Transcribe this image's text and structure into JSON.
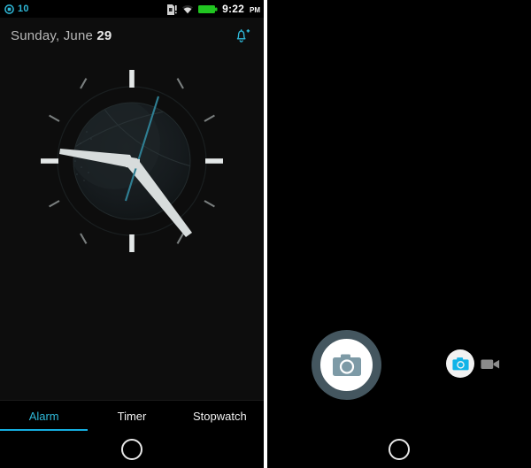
{
  "left_phone": {
    "app_name": "Clock",
    "statusbar": {
      "alarm_count": "10",
      "alarm_icon": "alarm-clock-icon",
      "sim_icon": "sim-card-alert-icon",
      "wifi_icon": "wifi-icon",
      "battery_icon": "battery-full-icon",
      "time": "9:22",
      "ampm": "PM",
      "battery_color": "#21c521",
      "accent_color": "#2fb8d8"
    },
    "header": {
      "date_prefix": "Sunday, June ",
      "date_day": "29",
      "date_full": "Sunday, June 29",
      "add_alarm_icon": "add-alarm-bell-icon"
    },
    "clock": {
      "type": "analog",
      "displayed_time": "9:22",
      "hour_hand_degrees": 281,
      "minute_hand_degrees": 132,
      "second_hand_degrees": 23,
      "hand_color": "#d7dcdc",
      "second_hand_color": "#2f7f93",
      "tick_major_color": "#e4e8e8",
      "tick_minor_color": "#7a7f7f",
      "dial_color": "#121616",
      "globe_color": "#1b2124"
    },
    "tabs": [
      {
        "label": "Alarm",
        "active": true
      },
      {
        "label": "Timer",
        "active": false
      },
      {
        "label": "Stopwatch",
        "active": false
      }
    ],
    "navbar": {
      "home_icon": "home-circle-icon"
    }
  },
  "right_phone": {
    "app_name": "Camera",
    "viewfinder": {
      "state": "black-preview",
      "background_color": "#000000"
    },
    "controls": {
      "shutter_icon": "camera-shutter-icon",
      "shutter_ring_color": "#44565f",
      "shutter_fill_color": "#ffffff",
      "shutter_glyph_color": "#7d9aa6",
      "mode_photo_icon": "camera-photo-mode-icon",
      "mode_photo_color": "#11b4e8",
      "mode_video_icon": "video-camcorder-icon",
      "mode_video_color": "#8b8b8b",
      "selected_mode": "photo"
    },
    "navbar": {
      "home_icon": "home-circle-icon"
    }
  },
  "layout": {
    "divider_color": "#ffffff"
  }
}
